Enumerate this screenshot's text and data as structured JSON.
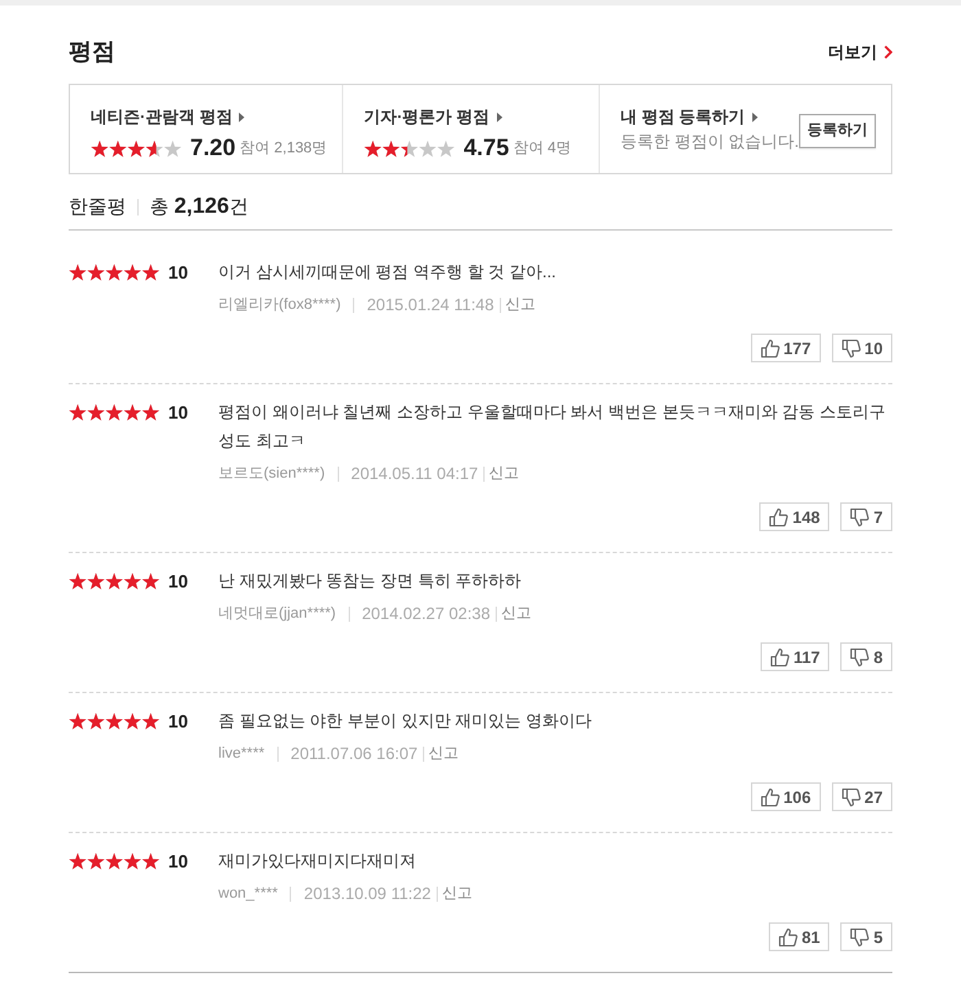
{
  "section_title": "평점",
  "more_link": {
    "label": "더보기"
  },
  "summary": [
    {
      "kind": "rating",
      "label": "네티즌·관람객 평점",
      "stars": 3.6,
      "score": "7.20",
      "participants": "참여 2,138명"
    },
    {
      "kind": "rating",
      "label": "기자·평론가 평점",
      "stars": 2.375,
      "score": "4.75",
      "participants": "참여 4명"
    },
    {
      "kind": "register",
      "label": "내 평점 등록하기",
      "message": "등록한 평점이 없습니다.",
      "button": "등록하기"
    }
  ],
  "reviews_header": {
    "title": "한줄평",
    "total": "총 **2,126**건"
  },
  "reviews": [
    {
      "stars": 5,
      "score": "10",
      "text": "이거 삼시세끼때문에 평점 역주행 할 것 같아...",
      "author": "리엘리카(fox8****)",
      "date": "2015.01.24 11:48",
      "report": "신고",
      "likes": "177",
      "dislikes": "10"
    },
    {
      "stars": 5,
      "score": "10",
      "text": "평점이 왜이러냐 칠년째 소장하고 우울할때마다 봐서 백번은 본듯ㅋㅋ재미와 감동 스토리구성도 최고ㅋ",
      "author": "보르도(sien****)",
      "date": "2014.05.11 04:17",
      "report": "신고",
      "likes": "148",
      "dislikes": "7"
    },
    {
      "stars": 5,
      "score": "10",
      "text": "난 재밌게봤다 똥참는 장면 특히 푸하하하",
      "author": "네멋대로(jjan****)",
      "date": "2014.02.27 02:38",
      "report": "신고",
      "likes": "117",
      "dislikes": "8"
    },
    {
      "stars": 5,
      "score": "10",
      "text": "좀 필요없는 야한 부분이 있지만 재미있는 영화이다",
      "author": "live****",
      "date": "2011.07.06 16:07",
      "report": "신고",
      "likes": "106",
      "dislikes": "27"
    },
    {
      "stars": 5,
      "score": "10",
      "text": "재미가있다재미지다재미져",
      "author": "won_****",
      "date": "2013.10.09 11:22",
      "report": "신고",
      "likes": "81",
      "dislikes": "5"
    }
  ]
}
